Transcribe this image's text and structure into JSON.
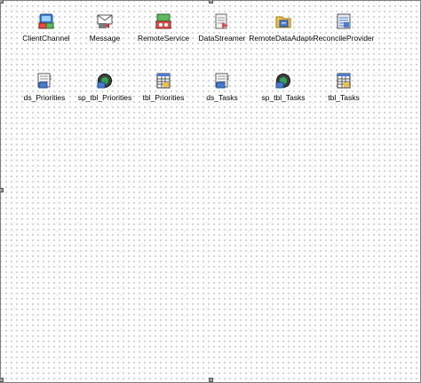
{
  "components_row1": [
    {
      "label": "ClientChannel",
      "icon": "client-channel-icon"
    },
    {
      "label": "Message",
      "icon": "message-icon"
    },
    {
      "label": "RemoteService",
      "icon": "remote-service-icon"
    },
    {
      "label": "DataStreamer",
      "icon": "data-streamer-icon"
    },
    {
      "label": "RemoteDataAdapter",
      "icon": "remote-data-adapter-icon"
    },
    {
      "label": "ReconcileProvider",
      "icon": "reconcile-provider-icon"
    }
  ],
  "components_row2": [
    {
      "label": "ds_Priorities",
      "icon": "dataset-icon"
    },
    {
      "label": "sp_tbl_Priorities",
      "icon": "stored-procedure-icon"
    },
    {
      "label": "tbl_Priorities",
      "icon": "table-icon"
    },
    {
      "label": "ds_Tasks",
      "icon": "dataset-icon"
    },
    {
      "label": "sp_tbl_Tasks",
      "icon": "stored-procedure-icon"
    },
    {
      "label": "tbl_Tasks",
      "icon": "table-icon"
    }
  ]
}
